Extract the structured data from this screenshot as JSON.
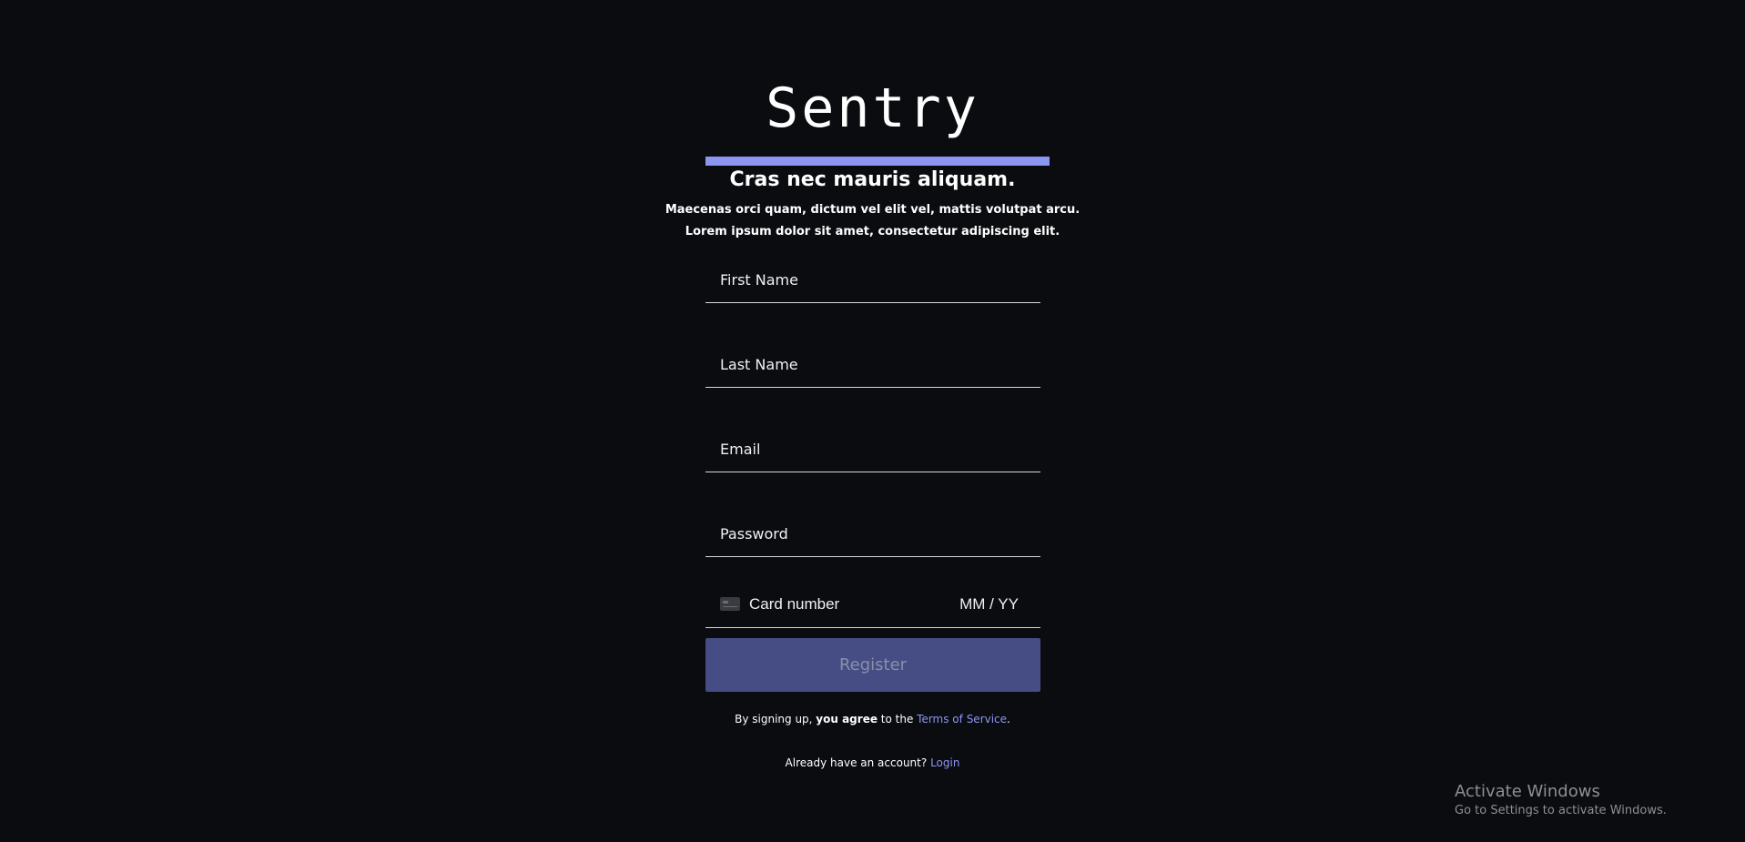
{
  "brand": {
    "name": "Sentry",
    "accent_color": "#8c95f2"
  },
  "intro": {
    "heading": "Cras nec mauris aliquam.",
    "line1": "Maecenas orci quam, dictum vel elit vel, mattis volutpat arcu.",
    "line2": "Lorem ipsum dolor sit amet, consectetur adipiscing elit."
  },
  "form": {
    "first_name": {
      "placeholder": "First Name",
      "value": ""
    },
    "last_name": {
      "placeholder": "Last Name",
      "value": ""
    },
    "email": {
      "placeholder": "Email",
      "value": ""
    },
    "password": {
      "placeholder": "Password",
      "value": ""
    },
    "card": {
      "icon": "credit-card-icon",
      "number_placeholder": "Card number",
      "expiry_placeholder": "MM / YY"
    },
    "submit_label": "Register",
    "submit_color": "#454d84"
  },
  "terms": {
    "prefix": "By signing up, ",
    "emphasis": "you agree",
    "middle": " to the ",
    "link": "Terms of Service",
    "suffix": "."
  },
  "login": {
    "prompt": "Already have an account? ",
    "link": "Login"
  },
  "watermark": {
    "title": "Activate Windows",
    "subtitle": "Go to Settings to activate Windows."
  }
}
